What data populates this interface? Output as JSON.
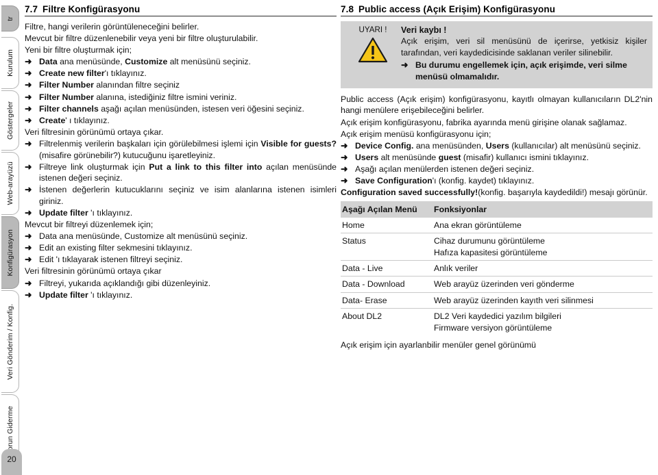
{
  "sidebar": {
    "tabs": [
      {
        "label": "tr",
        "active": true,
        "kind": "lang"
      },
      {
        "label": "Kurulum",
        "active": false,
        "kind": "chapter"
      },
      {
        "label": "Göstergeler",
        "active": false,
        "kind": "chapter"
      },
      {
        "label": "Web-arayüzü",
        "active": false,
        "kind": "chapter"
      },
      {
        "label": "Konfigürasyon",
        "active": true,
        "kind": "chapter"
      },
      {
        "label": "Veri Gönderim / Konfig.",
        "active": false,
        "kind": "chapter"
      },
      {
        "label": "Sorun Giderme",
        "active": false,
        "kind": "chapter"
      }
    ],
    "page_number": "20"
  },
  "left": {
    "section_number": "7.7",
    "section_title": "Filtre Konfigürasyonu",
    "intro": [
      "Filtre, hangi verilerin görüntüleneceğini belirler.",
      "Mevcut bir filtre düzenlenebilir veya yeni bir filtre oluşturulabilir.",
      "Yeni bir filtre oluşturmak için;"
    ],
    "steps_new": [
      {
        "html": "<b>Data</b> ana menüsünde, <b>Customize</b> alt menüsünü seçiniz."
      },
      {
        "html": "<b>Create new filter</b>'ı tıklayınız."
      },
      {
        "html": "<b>Filter Number</b> alanından filtre seçiniz"
      },
      {
        "html": "<b>Filter Number</b> alanına, istediğiniz filtre ismini veriniz."
      },
      {
        "html": "<b>Filter channels</b> aşağı açılan menüsünden, istesen veri öğesini seçiniz."
      },
      {
        "html": "<b>Create</b>' ı tıklayınız."
      }
    ],
    "mid_text": "Veri filtresinin görünümü ortaya çıkar.",
    "steps_detail": [
      {
        "html": "Filtrelenmiş verilerin başkaları için görülebilmesi işlemi için <b>Visible for guests?</b> (misafire görünebilir?) kutucuğunu işaretleyiniz."
      },
      {
        "html": "Filtreye link oluşturmak için <b>Put a link to this filter into</b> açılan menüsünde istenen değeri seçiniz."
      },
      {
        "html": "İstenen değerlerin kutucuklarını seçiniz ve isim alanlarına istenen isimleri giriniz."
      },
      {
        "html": "<b>Update filter</b> 'ı tıklayınız."
      }
    ],
    "edit_intro": "Mevcut bir filtreyi düzenlemek için;",
    "steps_edit": [
      {
        "html": "Data ana menüsünde, Customize alt menüsünü seçiniz."
      },
      {
        "html": "Edit an existing filter sekmesini tıklayınız."
      },
      {
        "html": "Edit 'ı tıklayarak istenen filtreyi seçiniz."
      }
    ],
    "edit_mid": "Veri filtresinin görünümü ortaya çıkar",
    "steps_edit2": [
      {
        "html": "Filtreyi, yukarıda açıklandığı gibi düzenleyiniz."
      },
      {
        "html": "<b>Update filter</b> 'ı tıklayınız."
      }
    ]
  },
  "right": {
    "section_number": "7.8",
    "section_title": "Public access (Açık Erişim) Konfigürasyonu",
    "warning": {
      "word": "UYARI !",
      "icon": "warning-triangle-icon",
      "heading": "Veri kaybı !",
      "body": "Açık erişim, veri sil menüsünü de içerirse, yetkisiz kişiler tarafından, veri kaydedicisinde saklanan veriler silinebilir.",
      "bullet": "Bu durumu engellemek için, açık erişimde, veri silme menüsü olmamalıdır.",
      "bg_color": "#d2d2d2",
      "icon_color": "#f5c518"
    },
    "paragraphs": [
      "Public access (Açık erişim) konfigürasyonu, kayıtlı olmayan kullanıcıların DL2'nin hangi menülere erişebileceğini belirler.",
      "Açık erişim konfigürasyonu, fabrika ayarında menü girişine olanak sağlamaz.",
      "Açık erişim menüsü konfigürasyonu için;"
    ],
    "steps": [
      {
        "html": "<b>Device Config.</b> ana menüsünden, <b>Users</b> (kullanıcılar) alt menüsünü seçiniz."
      },
      {
        "html": "<b>Users</b> alt menüsünde <b>guest</b> (misafir) kullanıcı ismini tıklayınız."
      },
      {
        "html": "Aşağı açılan menülerden istenen değeri seçiniz."
      },
      {
        "html": "<b>Save Configuration</b>'ı (konfig. kaydet) tıklayınız."
      }
    ],
    "confirm": "<b>Configuration saved successfully!</b>(konfig. başarıyla kaydedildi!) mesajı görünür.",
    "table": {
      "headers": [
        "Aşağı Açılan Menü",
        "Fonksiyonlar"
      ],
      "rows": [
        {
          "menu": "Home",
          "functions": [
            "Ana ekran görüntüleme"
          ]
        },
        {
          "menu": "Status",
          "functions": [
            "Cihaz durumunu görüntüleme",
            "Hafıza kapasitesi görüntüleme"
          ]
        },
        {
          "menu": "Data - Live",
          "functions": [
            "Anlık veriler"
          ]
        },
        {
          "menu": "Data - Download",
          "functions": [
            "Web arayüz üzerinden veri gönderme"
          ]
        },
        {
          "menu": "Data- Erase",
          "functions": [
            "Web arayüz üzerinden kayıth veri silinmesi"
          ]
        },
        {
          "menu": "About DL2",
          "functions": [
            "DL2 Veri kaydedici yazılım bilgileri",
            "Firmware versiyon görüntüleme"
          ]
        }
      ]
    },
    "caption": "Açık erişim için ayarlanbilir menüler genel görünümü"
  }
}
